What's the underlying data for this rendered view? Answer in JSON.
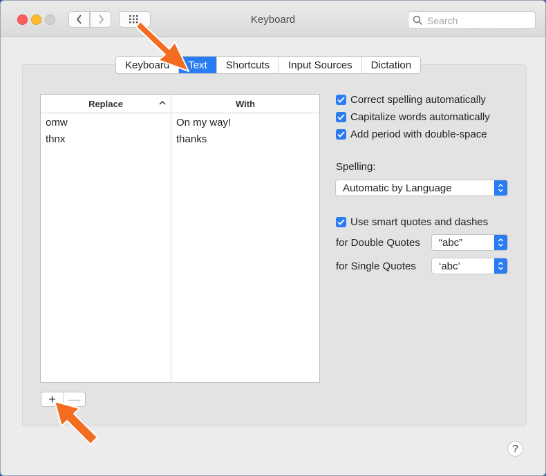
{
  "window": {
    "title": "Keyboard"
  },
  "search": {
    "placeholder": "Search"
  },
  "tabs": [
    {
      "label": "Keyboard",
      "active": false
    },
    {
      "label": "Text",
      "active": true
    },
    {
      "label": "Shortcuts",
      "active": false
    },
    {
      "label": "Input Sources",
      "active": false
    },
    {
      "label": "Dictation",
      "active": false
    }
  ],
  "table": {
    "headers": {
      "replace": "Replace",
      "with": "With"
    },
    "rows": [
      {
        "replace": "omw",
        "with": "On my way!"
      },
      {
        "replace": "thnx",
        "with": "thanks"
      }
    ]
  },
  "buttons": {
    "add": "+",
    "remove": "—",
    "help": "?"
  },
  "options": {
    "correct_spelling": "Correct spelling automatically",
    "capitalize_words": "Capitalize words automatically",
    "add_period": "Add period with double-space",
    "spelling_label": "Spelling:",
    "spelling_value": "Automatic by Language",
    "smart_quotes": "Use smart quotes and dashes",
    "double_quotes_label": "for Double Quotes",
    "double_quotes_value": "“abc”",
    "single_quotes_label": "for Single Quotes",
    "single_quotes_value": "‘abc’"
  },
  "colors": {
    "accent": "#2a7cf3",
    "annotation_arrow": "#f26c22"
  },
  "icons": [
    "chevron-left-icon",
    "chevron-right-icon",
    "grid-icon",
    "search-icon",
    "sort-up-icon",
    "checkmark-icon",
    "updown-arrows-icon",
    "orange-arrow-icon"
  ]
}
